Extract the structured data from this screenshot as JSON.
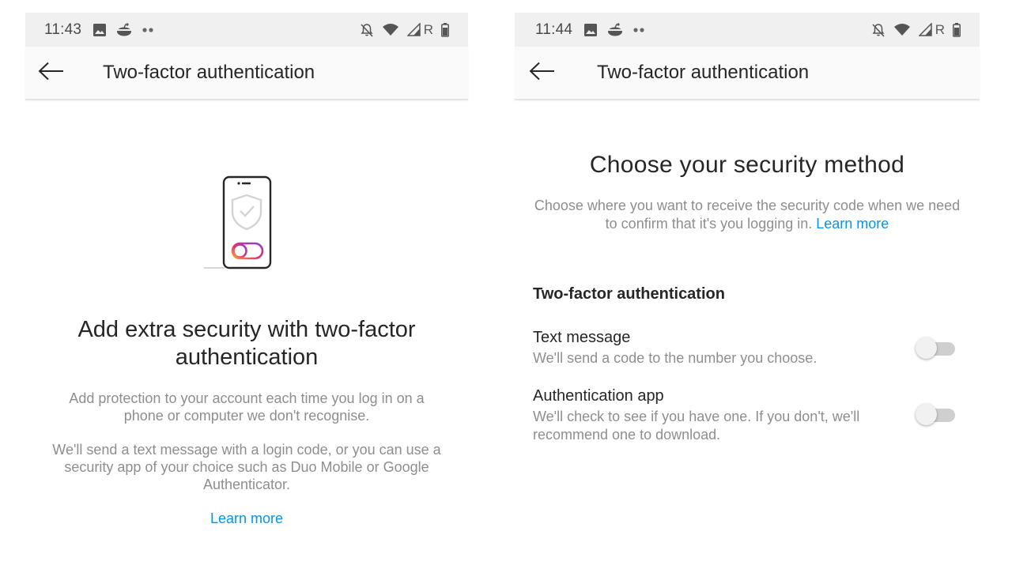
{
  "screens": [
    {
      "status_bar": {
        "time": "11:43",
        "left_icons": [
          "image-icon",
          "reddit-icon",
          "more-dots-icon"
        ],
        "right_icons": [
          "bell-off-icon",
          "wifi-icon",
          "signal-icon",
          "roaming-indicator",
          "battery-icon"
        ],
        "roaming_label": "R"
      },
      "app_bar": {
        "back_icon": "arrow-left-icon",
        "title": "Two-factor authentication"
      },
      "illustration": "phone-shield-toggle-illustration",
      "heading": "Add extra security with two-factor authentication",
      "body_1": "Add protection to your account each time you log in on a phone or computer we don't recognise.",
      "body_2": "We'll send a text message with a login code, or you can use a security app of your choice such as Duo Mobile or Google Authenticator.",
      "learn_more": "Learn more"
    },
    {
      "status_bar": {
        "time": "11:44",
        "left_icons": [
          "image-icon",
          "reddit-icon",
          "more-dots-icon"
        ],
        "right_icons": [
          "bell-off-icon",
          "wifi-icon",
          "signal-icon",
          "roaming-indicator",
          "battery-icon"
        ],
        "roaming_label": "R"
      },
      "app_bar": {
        "back_icon": "arrow-left-icon",
        "title": "Two-factor authentication"
      },
      "heading": "Choose your security method",
      "description": "Choose where you want to receive the security code when we need to confirm that it's you logging in.",
      "learn_more": "Learn more",
      "section_title": "Two-factor authentication",
      "options": [
        {
          "label": "Text message",
          "description": "We'll send a code to the number you choose.",
          "enabled": false
        },
        {
          "label": "Authentication app",
          "description": "We'll check to see if you have one. If you don't, we'll recommend one to download.",
          "enabled": false
        }
      ]
    }
  ],
  "colors": {
    "link": "#0095f6",
    "primary_text": "#262626",
    "secondary_text": "#8e8e8e",
    "status_bar_bg": "#f0f0f0",
    "app_bar_bg": "#fafafa",
    "toggle_off_track": "#cfcfcf"
  }
}
